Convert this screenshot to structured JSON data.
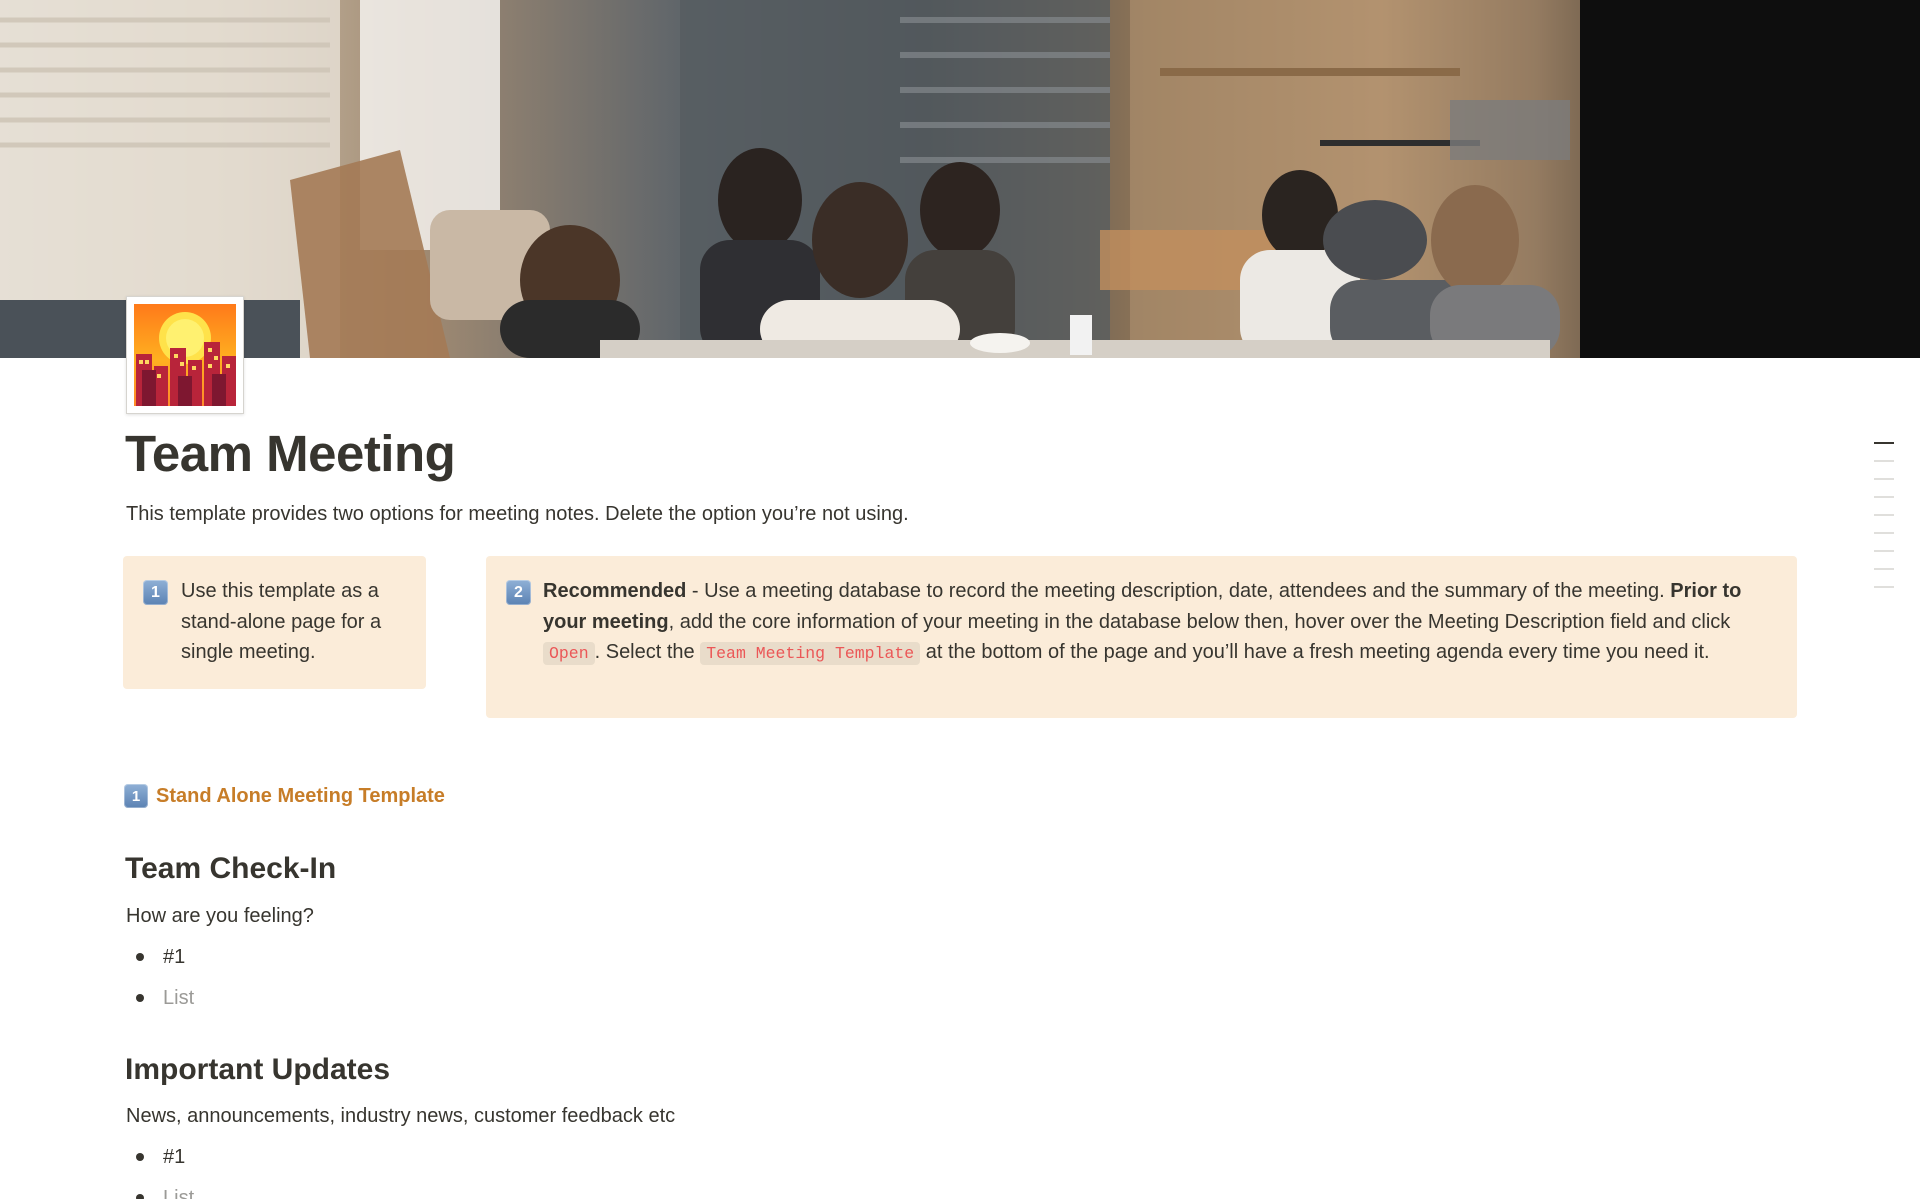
{
  "page": {
    "title": "Team Meeting",
    "description": "This template provides two options for meeting notes. Delete the option you’re not using."
  },
  "cover": {
    "alt": "cover-image"
  },
  "page_icon": {
    "name": "cityscape-at-sunset-icon"
  },
  "callouts": [
    {
      "badge": "1",
      "text": "Use this template as a stand-alone page for a single meeting."
    },
    {
      "badge": "2",
      "bold1": "Recommended",
      "text1": " - Use a meeting database to record the meeting description, date, attendees and the summary of the meeting. ",
      "bold2": "Prior to your meeting",
      "text2": ", add the core information of your meeting in the database below then, hover over the Meeting Description field and click ",
      "code1": "Open",
      "text3": ". Select the ",
      "code2": "Team Meeting Template",
      "text4": " at the bottom of the page and you’ll have a fresh meeting agenda every time you need it."
    }
  ],
  "section_link": {
    "badge": "1",
    "label": "Stand Alone Meeting Template"
  },
  "sections": [
    {
      "heading": "Team Check-In",
      "prompt": "How are you feeling?",
      "items": [
        "#1",
        "List"
      ]
    },
    {
      "heading": "Important Updates",
      "prompt": "News, announcements, industry news, customer feedback etc",
      "items": [
        "#1",
        "List"
      ]
    }
  ],
  "colors": {
    "callout_bg": "#fbecd9",
    "link": "#c77d28",
    "code_text": "#eb5757",
    "text": "#37352f",
    "placeholder": "#9b9a97"
  }
}
